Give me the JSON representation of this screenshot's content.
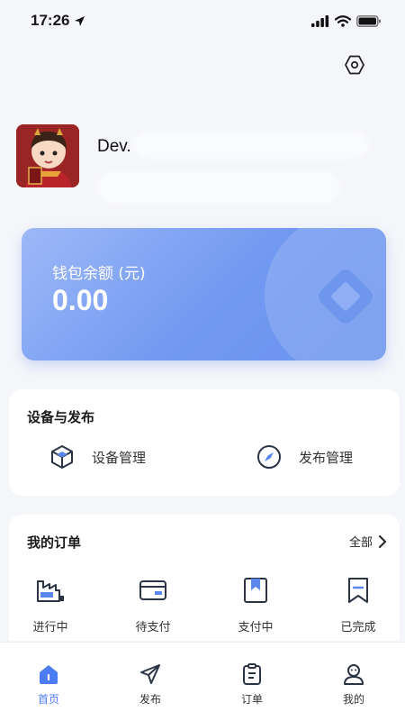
{
  "status_bar": {
    "time": "17:26"
  },
  "profile": {
    "username": "Dev."
  },
  "wallet": {
    "title": "钱包余额 (元)",
    "amount": "0.00"
  },
  "devices": {
    "title": "设备与发布",
    "items": [
      {
        "label": "设备管理",
        "icon": "cube-icon"
      },
      {
        "label": "发布管理",
        "icon": "compass-icon"
      }
    ]
  },
  "orders": {
    "title": "我的订单",
    "see_all": "全部",
    "items": [
      {
        "label": "进行中",
        "icon": "factory-icon"
      },
      {
        "label": "待支付",
        "icon": "card-icon"
      },
      {
        "label": "支付中",
        "icon": "bookmark-box-icon"
      },
      {
        "label": "已完成",
        "icon": "bookmark-check-icon"
      }
    ]
  },
  "tabs": [
    {
      "label": "首页",
      "icon": "home-icon",
      "active": true
    },
    {
      "label": "发布",
      "icon": "send-icon",
      "active": false
    },
    {
      "label": "订单",
      "icon": "clipboard-icon",
      "active": false
    },
    {
      "label": "我的",
      "icon": "user-icon",
      "active": false
    }
  ],
  "colors": {
    "accent": "#4c7cf3",
    "wallet_gradient_start": "#9db8f7",
    "wallet_gradient_end": "#6a93ee",
    "background": "#f5f6fa"
  }
}
